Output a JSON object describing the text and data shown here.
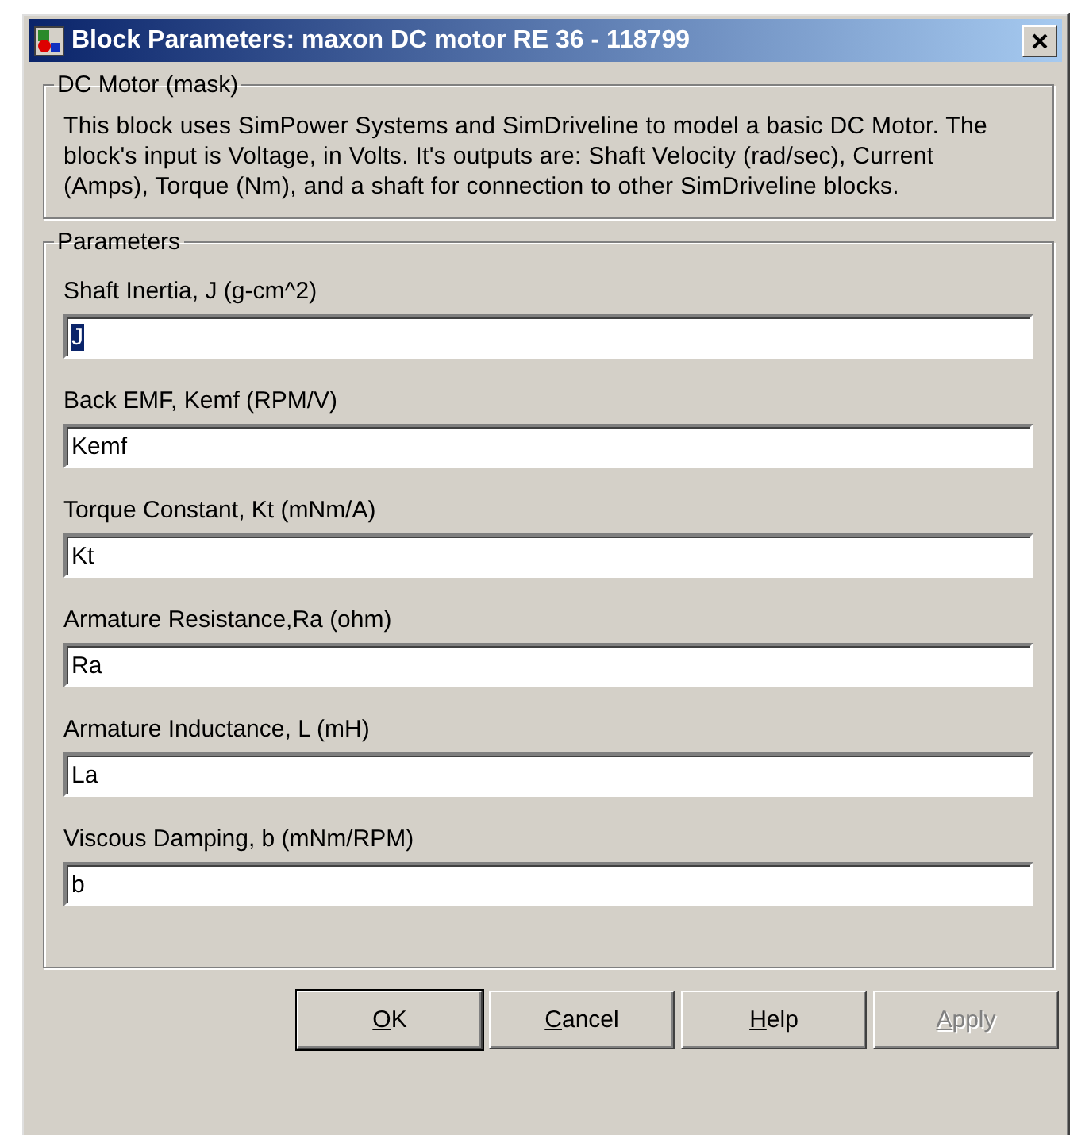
{
  "window": {
    "title": "Block Parameters: maxon DC motor RE 36 - 118799"
  },
  "description_group": {
    "title": "DC Motor (mask)",
    "text": "This block uses SimPower Systems and SimDriveline to model a basic DC Motor. The block's input is Voltage, in Volts.  It's outputs are: Shaft Velocity (rad/sec), Current (Amps), Torque (Nm), and a shaft for connection to other SimDriveline blocks."
  },
  "parameters_group": {
    "title": "Parameters",
    "fields": [
      {
        "label": "Shaft Inertia, J (g-cm^2)",
        "value": "J",
        "selected": true
      },
      {
        "label": "Back EMF, Kemf (RPM/V)",
        "value": "Kemf",
        "selected": false
      },
      {
        "label": "Torque Constant, Kt (mNm/A)",
        "value": "Kt",
        "selected": false
      },
      {
        "label": "Armature Resistance,Ra (ohm)",
        "value": "Ra",
        "selected": false
      },
      {
        "label": "Armature Inductance, L (mH)",
        "value": "La",
        "selected": false
      },
      {
        "label": "Viscous Damping, b (mNm/RPM)",
        "value": "b",
        "selected": false
      }
    ]
  },
  "buttons": [
    {
      "label": "OK",
      "default": true,
      "disabled": false
    },
    {
      "label": "Cancel",
      "default": false,
      "disabled": false
    },
    {
      "label": "Help",
      "default": false,
      "disabled": false
    },
    {
      "label": "Apply",
      "default": false,
      "disabled": true
    }
  ]
}
